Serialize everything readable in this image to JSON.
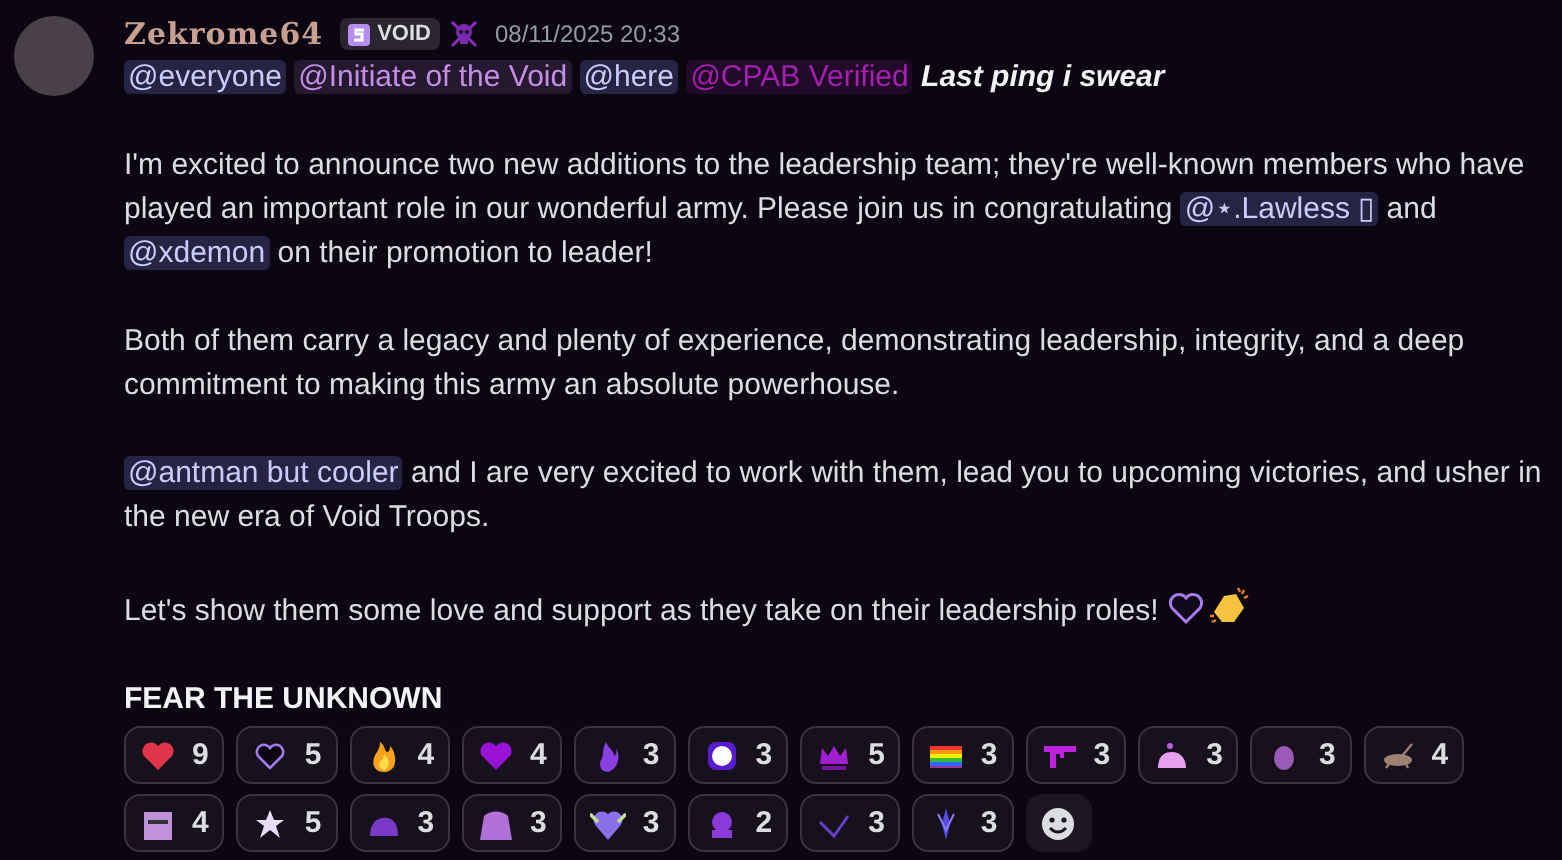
{
  "message": {
    "author": "Zekrome64",
    "tag": "VOID",
    "timestamp": "08/11/2025 20:33",
    "paragraphs": [
      [
        {
          "kind": "mention",
          "text": "@everyone"
        },
        {
          "kind": "mention",
          "text": "@Initiate of the Void",
          "color": "#c48ee6"
        },
        {
          "kind": "mention",
          "text": "@here"
        },
        {
          "kind": "mention",
          "text": "@CPAB Verified",
          "color": "#a51fb0"
        },
        {
          "kind": "emphasis",
          "text": "Last ping i swear"
        }
      ],
      [
        {
          "kind": "text",
          "text": "I'm excited to announce two new additions to the leadership team; they're well-known members who have played an important role in our wonderful army.  Please join us in congratulating "
        },
        {
          "kind": "mention",
          "text": "@⋆.Lawless ▯"
        },
        {
          "kind": "text",
          "text": "and "
        },
        {
          "kind": "mention",
          "text": "@xdemon"
        },
        {
          "kind": "text",
          "text": " on their promotion to leader!"
        }
      ],
      [
        {
          "kind": "text",
          "text": "Both of them carry a legacy and plenty of experience, demonstrating leadership, integrity, and a deep commitment to making this army an absolute powerhouse."
        }
      ],
      [
        {
          "kind": "mention",
          "text": "@antman but cooler"
        },
        {
          "kind": "text",
          "text": "and I are very excited to work with them, lead you to upcoming victories, and usher in the new era of Void Troops."
        }
      ],
      [
        {
          "kind": "text",
          "text": "Let's show them some love and support as they take on their leadership roles! "
        },
        {
          "kind": "emoji"
        },
        {
          "kind": "emoji"
        }
      ],
      [
        {
          "kind": "strong",
          "text": "FEAR THE UNKNOWN"
        }
      ]
    ],
    "reactions": [
      {
        "count": "9"
      },
      {
        "count": "5"
      },
      {
        "count": "4"
      },
      {
        "count": "4"
      },
      {
        "count": "3"
      },
      {
        "count": "3"
      },
      {
        "count": "5"
      },
      {
        "count": "3"
      },
      {
        "count": "3"
      },
      {
        "count": "3"
      },
      {
        "count": "3"
      },
      {
        "count": "4"
      },
      {
        "count": "4"
      },
      {
        "count": "5"
      },
      {
        "count": "3"
      },
      {
        "count": "3"
      },
      {
        "count": "3"
      },
      {
        "count": "2"
      },
      {
        "count": "3"
      },
      {
        "count": "3"
      }
    ]
  }
}
